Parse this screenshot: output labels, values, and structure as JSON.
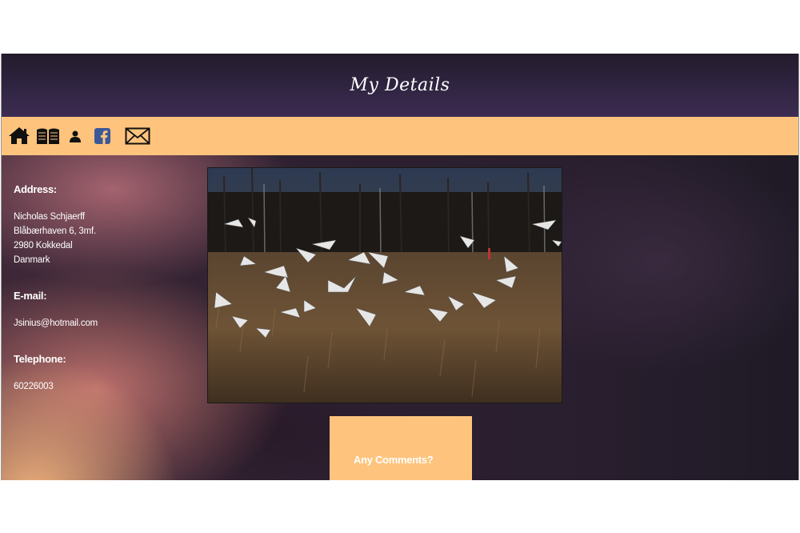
{
  "header": {
    "title": "My Details"
  },
  "nav": {
    "icons": [
      "home-icon",
      "book-icon",
      "user-icon",
      "facebook-icon",
      "envelope-icon"
    ],
    "background": "#fec47d"
  },
  "contact": {
    "address_label": "Address:",
    "address_lines": [
      "Nicholas Schjaerff",
      "Blåbærhaven 6, 3mf.",
      "2980 Kokkedal",
      "Danmark"
    ],
    "email_label": "E-mail:",
    "email": "Jsinius@hotmail.com",
    "telephone_label": "Telephone:",
    "telephone": "60226003"
  },
  "comments": {
    "title": "Any Comments?"
  }
}
